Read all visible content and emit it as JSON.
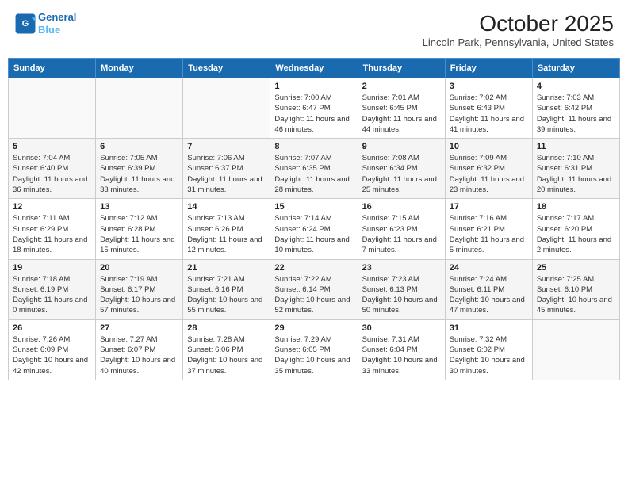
{
  "header": {
    "logo_line1": "General",
    "logo_line2": "Blue",
    "title": "October 2025",
    "subtitle": "Lincoln Park, Pennsylvania, United States"
  },
  "weekdays": [
    "Sunday",
    "Monday",
    "Tuesday",
    "Wednesday",
    "Thursday",
    "Friday",
    "Saturday"
  ],
  "weeks": [
    [
      {
        "day": "",
        "info": ""
      },
      {
        "day": "",
        "info": ""
      },
      {
        "day": "",
        "info": ""
      },
      {
        "day": "1",
        "info": "Sunrise: 7:00 AM\nSunset: 6:47 PM\nDaylight: 11 hours and 46 minutes."
      },
      {
        "day": "2",
        "info": "Sunrise: 7:01 AM\nSunset: 6:45 PM\nDaylight: 11 hours and 44 minutes."
      },
      {
        "day": "3",
        "info": "Sunrise: 7:02 AM\nSunset: 6:43 PM\nDaylight: 11 hours and 41 minutes."
      },
      {
        "day": "4",
        "info": "Sunrise: 7:03 AM\nSunset: 6:42 PM\nDaylight: 11 hours and 39 minutes."
      }
    ],
    [
      {
        "day": "5",
        "info": "Sunrise: 7:04 AM\nSunset: 6:40 PM\nDaylight: 11 hours and 36 minutes."
      },
      {
        "day": "6",
        "info": "Sunrise: 7:05 AM\nSunset: 6:39 PM\nDaylight: 11 hours and 33 minutes."
      },
      {
        "day": "7",
        "info": "Sunrise: 7:06 AM\nSunset: 6:37 PM\nDaylight: 11 hours and 31 minutes."
      },
      {
        "day": "8",
        "info": "Sunrise: 7:07 AM\nSunset: 6:35 PM\nDaylight: 11 hours and 28 minutes."
      },
      {
        "day": "9",
        "info": "Sunrise: 7:08 AM\nSunset: 6:34 PM\nDaylight: 11 hours and 25 minutes."
      },
      {
        "day": "10",
        "info": "Sunrise: 7:09 AM\nSunset: 6:32 PM\nDaylight: 11 hours and 23 minutes."
      },
      {
        "day": "11",
        "info": "Sunrise: 7:10 AM\nSunset: 6:31 PM\nDaylight: 11 hours and 20 minutes."
      }
    ],
    [
      {
        "day": "12",
        "info": "Sunrise: 7:11 AM\nSunset: 6:29 PM\nDaylight: 11 hours and 18 minutes."
      },
      {
        "day": "13",
        "info": "Sunrise: 7:12 AM\nSunset: 6:28 PM\nDaylight: 11 hours and 15 minutes."
      },
      {
        "day": "14",
        "info": "Sunrise: 7:13 AM\nSunset: 6:26 PM\nDaylight: 11 hours and 12 minutes."
      },
      {
        "day": "15",
        "info": "Sunrise: 7:14 AM\nSunset: 6:24 PM\nDaylight: 11 hours and 10 minutes."
      },
      {
        "day": "16",
        "info": "Sunrise: 7:15 AM\nSunset: 6:23 PM\nDaylight: 11 hours and 7 minutes."
      },
      {
        "day": "17",
        "info": "Sunrise: 7:16 AM\nSunset: 6:21 PM\nDaylight: 11 hours and 5 minutes."
      },
      {
        "day": "18",
        "info": "Sunrise: 7:17 AM\nSunset: 6:20 PM\nDaylight: 11 hours and 2 minutes."
      }
    ],
    [
      {
        "day": "19",
        "info": "Sunrise: 7:18 AM\nSunset: 6:19 PM\nDaylight: 11 hours and 0 minutes."
      },
      {
        "day": "20",
        "info": "Sunrise: 7:19 AM\nSunset: 6:17 PM\nDaylight: 10 hours and 57 minutes."
      },
      {
        "day": "21",
        "info": "Sunrise: 7:21 AM\nSunset: 6:16 PM\nDaylight: 10 hours and 55 minutes."
      },
      {
        "day": "22",
        "info": "Sunrise: 7:22 AM\nSunset: 6:14 PM\nDaylight: 10 hours and 52 minutes."
      },
      {
        "day": "23",
        "info": "Sunrise: 7:23 AM\nSunset: 6:13 PM\nDaylight: 10 hours and 50 minutes."
      },
      {
        "day": "24",
        "info": "Sunrise: 7:24 AM\nSunset: 6:11 PM\nDaylight: 10 hours and 47 minutes."
      },
      {
        "day": "25",
        "info": "Sunrise: 7:25 AM\nSunset: 6:10 PM\nDaylight: 10 hours and 45 minutes."
      }
    ],
    [
      {
        "day": "26",
        "info": "Sunrise: 7:26 AM\nSunset: 6:09 PM\nDaylight: 10 hours and 42 minutes."
      },
      {
        "day": "27",
        "info": "Sunrise: 7:27 AM\nSunset: 6:07 PM\nDaylight: 10 hours and 40 minutes."
      },
      {
        "day": "28",
        "info": "Sunrise: 7:28 AM\nSunset: 6:06 PM\nDaylight: 10 hours and 37 minutes."
      },
      {
        "day": "29",
        "info": "Sunrise: 7:29 AM\nSunset: 6:05 PM\nDaylight: 10 hours and 35 minutes."
      },
      {
        "day": "30",
        "info": "Sunrise: 7:31 AM\nSunset: 6:04 PM\nDaylight: 10 hours and 33 minutes."
      },
      {
        "day": "31",
        "info": "Sunrise: 7:32 AM\nSunset: 6:02 PM\nDaylight: 10 hours and 30 minutes."
      },
      {
        "day": "",
        "info": ""
      }
    ]
  ]
}
